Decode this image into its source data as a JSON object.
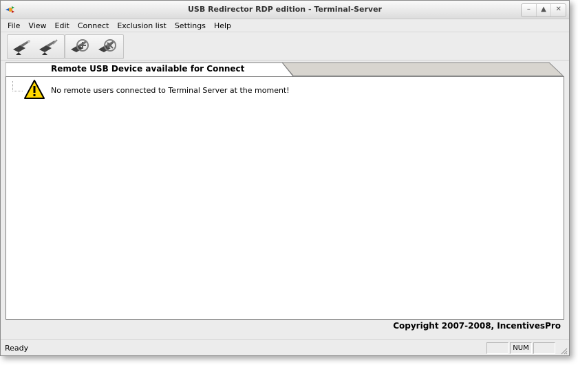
{
  "window": {
    "title": "USB Redirector RDP edition - Terminal-Server",
    "controls": [
      "–",
      "▲",
      "✕"
    ]
  },
  "menu": {
    "items": [
      "File",
      "View",
      "Edit",
      "Connect",
      "Exclusion list",
      "Settings",
      "Help"
    ]
  },
  "toolbar": {
    "buttons": [
      "connect-device-icon",
      "disconnect-device-icon",
      "add-device-icon",
      "remove-device-icon"
    ]
  },
  "tab": {
    "label": "Remote USB Device available for Connect"
  },
  "panel": {
    "message": "No remote users connected to Terminal Server at the moment!"
  },
  "footer": {
    "copyright": "Copyright 2007-2008, IncentivesPro"
  },
  "status": {
    "text": "Ready",
    "num": "NUM"
  },
  "colors": {
    "warning_fill": "#ffd800",
    "accent_red": "#d02020"
  }
}
